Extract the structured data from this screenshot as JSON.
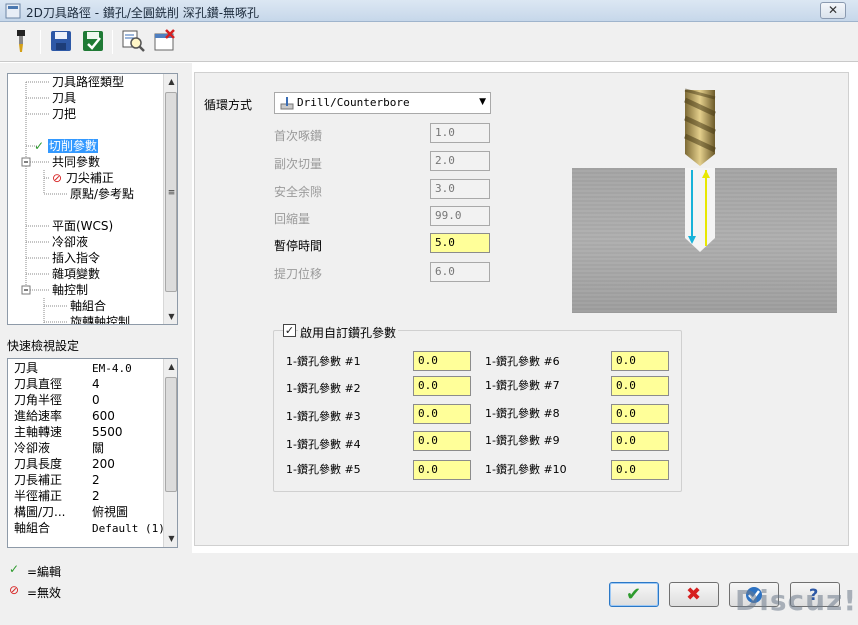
{
  "window": {
    "title": "2D刀具路徑 - 鑽孔/全圓銑削 深孔鑽-無啄孔",
    "close": "✕"
  },
  "toolbar": {
    "icons": [
      "tool-icon",
      "save-icon",
      "save-green-icon",
      "preview-icon",
      "delete-icon"
    ]
  },
  "tree": {
    "items": [
      {
        "label": "刀具路徑類型"
      },
      {
        "label": "刀具"
      },
      {
        "label": "刀把"
      },
      {
        "label": "切削參數",
        "mark": "✓"
      },
      {
        "label": "共同參數"
      },
      {
        "label": "刀尖補正",
        "mark": "⊘"
      },
      {
        "label": "原點/參考點"
      },
      {
        "label": "平面(WCS)"
      },
      {
        "label": "冷卻液"
      },
      {
        "label": "插入指令"
      },
      {
        "label": "雜項變數"
      },
      {
        "label": "軸控制"
      },
      {
        "label": "軸組合"
      },
      {
        "label": "旋轉軸控制"
      }
    ]
  },
  "quick": {
    "title": "快速檢視設定",
    "rows": [
      {
        "key": "刀具",
        "value": "EM-4.0"
      },
      {
        "key": "刀具直徑",
        "value": "4"
      },
      {
        "key": "刀角半徑",
        "value": "0"
      },
      {
        "key": "進給速率",
        "value": "600"
      },
      {
        "key": "主軸轉速",
        "value": "5500"
      },
      {
        "key": "冷卻液",
        "value": "關"
      },
      {
        "key": "刀具長度",
        "value": "200"
      },
      {
        "key": "刀長補正",
        "value": "2"
      },
      {
        "key": "半徑補正",
        "value": "2"
      },
      {
        "key": "構圖/刀...",
        "value": "俯視圖"
      },
      {
        "key": "軸組合",
        "value": "Default (1)"
      }
    ]
  },
  "legend": {
    "edit_mark": "✓",
    "edit_label": "=編輯",
    "invalid_mark": "⊘",
    "invalid_label": "=無效"
  },
  "params": {
    "cycle_label": "循環方式",
    "cycle_value": "Drill/Counterbore",
    "fields": [
      {
        "label": "首次啄鑽",
        "value": "1.0",
        "enabled": false
      },
      {
        "label": "副次切量",
        "value": "2.0",
        "enabled": false
      },
      {
        "label": "安全余隙",
        "value": "3.0",
        "enabled": false
      },
      {
        "label": "回縮量",
        "value": "99.0",
        "enabled": false
      },
      {
        "label": "暫停時間",
        "value": "5.0",
        "enabled": true
      },
      {
        "label": "提刀位移",
        "value": "6.0",
        "enabled": false
      }
    ]
  },
  "custom": {
    "checkbox_label": "啟用自訂鑽孔參數",
    "checked": true,
    "check_mark": "✓",
    "left": [
      {
        "label": "1-鑽孔參數 #1",
        "value": "0.0"
      },
      {
        "label": "1-鑽孔參數 #2",
        "value": "0.0"
      },
      {
        "label": "1-鑽孔參數 #3",
        "value": "0.0"
      },
      {
        "label": "1-鑽孔參數 #4",
        "value": "0.0"
      },
      {
        "label": "1-鑽孔參數 #5",
        "value": "0.0"
      }
    ],
    "right": [
      {
        "label": "1-鑽孔參數 #6",
        "value": "0.0"
      },
      {
        "label": "1-鑽孔參數 #7",
        "value": "0.0"
      },
      {
        "label": "1-鑽孔參數 #8",
        "value": "0.0"
      },
      {
        "label": "1-鑽孔參數 #9",
        "value": "0.0"
      },
      {
        "label": "1-鑽孔參數 #10",
        "value": "0.0"
      }
    ]
  },
  "buttons": {
    "ok": "✔",
    "cancel": "✖",
    "help": "?"
  },
  "watermark": "Discuz!",
  "colors": {
    "selection": "#3399ff",
    "active_field": "#ffff99",
    "check": "#2e9b2e",
    "invalid": "#d62020"
  }
}
